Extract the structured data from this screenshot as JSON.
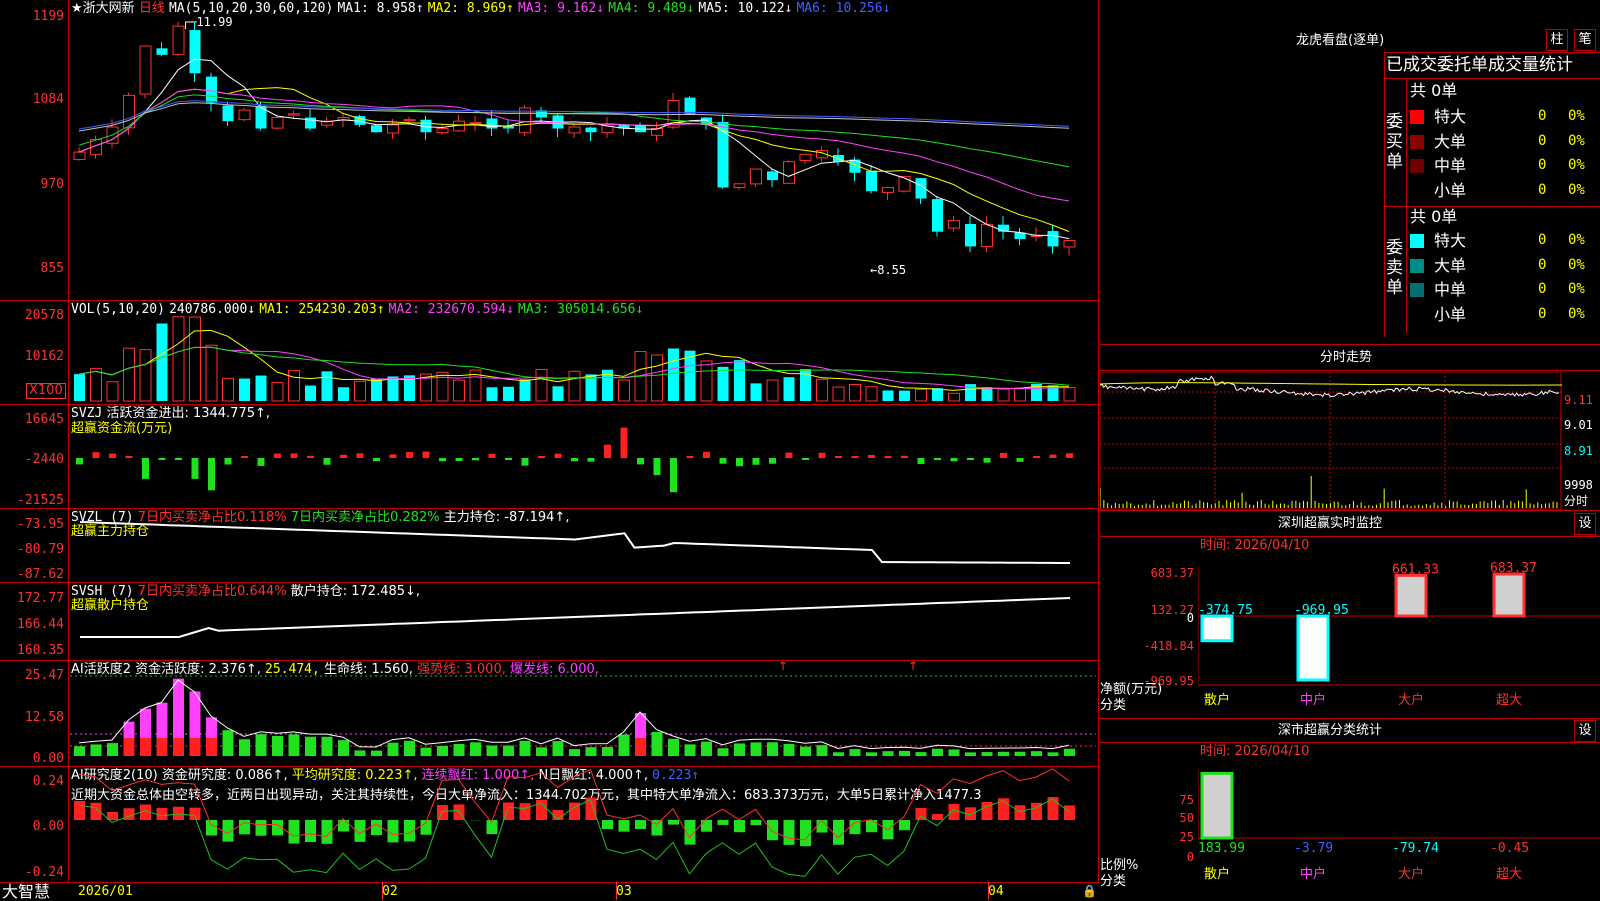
{
  "app": {
    "name": "大智慧"
  },
  "main_header": {
    "star": "★",
    "stock_name": "浙大网新",
    "period": "日线",
    "ma_params": "MA(5,10,20,30,60,120)",
    "ma1": "MA1: 8.958↑",
    "ma2": "MA2: 8.969↑",
    "ma3": "MA3: 9.162↓",
    "ma4": "MA4: 9.489↓",
    "ma5": "MA5: 10.122↓",
    "ma6": "MA6: 10.256↓",
    "high_mark": "11.99",
    "low_mark": "8.55"
  },
  "price_axis": [
    "1199",
    "1084",
    "970",
    "855"
  ],
  "vol_header": {
    "label": "VOL(5,10,20)",
    "value": "240786.000↓",
    "ma1": "MA1: 254230.203↑",
    "ma2": "MA2: 232670.594↓",
    "ma3": "MA3: 305014.656↓"
  },
  "vol_axis": [
    "20578",
    "10162",
    "X100"
  ],
  "svzj_header": {
    "label": "SVZJ",
    "desc": "活跃资金进出: 1344.775↑,",
    "sub": "超赢资金流(万元)"
  },
  "svzj_axis": [
    "16645",
    "-2440",
    "-21525"
  ],
  "svzl_header": {
    "label": "SVZL (7)",
    "a": "7日内买卖净占比0.118%",
    "b": "7日内买卖净占比0.282%",
    "c": "主力持仓: -87.194↑,",
    "sub": "超赢主力持仓"
  },
  "svzl_axis": [
    "-73.95",
    "-80.79",
    "-87.62"
  ],
  "svsh_header": {
    "label": "SVSH (7)",
    "a": "7日内买卖净占比0.644%",
    "c": "散户持仓: 172.485↓,",
    "sub": "超赢散户持仓"
  },
  "svsh_axis": [
    "172.77",
    "166.44",
    "160.35"
  ],
  "ai1_header": {
    "label": "AI活跃度2",
    "a": "资金活跃度: 2.376↑,",
    "b": "25.474,",
    "c": "生命线: 1.560,",
    "d": "强势线: 3.000,",
    "e": "爆发线: 6.000,"
  },
  "ai1_axis": [
    "25.47",
    "12.58",
    "0.00"
  ],
  "ai2_header": {
    "label": "AI研究度2(10)",
    "a": "资金研究度: 0.086↑,",
    "b": "平均研究度: 0.223↑,",
    "c": "连续飘红: 1.000↑,",
    "d": "N日飘红: 4.000↑,",
    "e": "0.223↑"
  },
  "ai2_comment": "近期大资金总体由空转多，近两日出现异动，关注其持续性，今日大单净流入：1344.702万元，其中特大单净流入：683.373万元，大单5日累计净入1477.3",
  "ai2_axis": [
    "0.24",
    "0.00",
    "-0.24"
  ],
  "date_axis": [
    "2026/01",
    "02",
    "03",
    "04"
  ],
  "right_top": {
    "title": "龙虎看盘(逐单)",
    "btn1": "柱",
    "btn2": "笔",
    "tabs": "已成交委托单成交量统计",
    "buy_label": "委买单",
    "sell_label": "委卖单",
    "buy_total": "共 0单",
    "sell_total": "共 0单",
    "buy_rows": [
      {
        "name": "特大",
        "count": "0",
        "pct": "0%"
      },
      {
        "name": "大单",
        "count": "0",
        "pct": "0%"
      },
      {
        "name": "中单",
        "count": "0",
        "pct": "0%"
      },
      {
        "name": "小单",
        "count": "0",
        "pct": "0%"
      }
    ],
    "sell_rows": [
      {
        "name": "特大",
        "count": "0",
        "pct": "0%"
      },
      {
        "name": "大单",
        "count": "0",
        "pct": "0%"
      },
      {
        "name": "中单",
        "count": "0",
        "pct": "0%"
      },
      {
        "name": "小单",
        "count": "0",
        "pct": "0%"
      }
    ],
    "colors": {
      "buy": [
        "#ff0000",
        "#8b0000",
        "#700000",
        "#000000"
      ],
      "sell": [
        "#00ffff",
        "#008b8b",
        "#007070",
        "#000000"
      ]
    }
  },
  "intraday": {
    "title": "分时走势",
    "axis": [
      "9.11",
      "9.01",
      "8.91"
    ],
    "vol_label": "9998",
    "sub": "分时"
  },
  "sz_monitor": {
    "title": "深圳超赢实时监控",
    "btn": "设",
    "time": "时间: 2026/04/10",
    "axis": [
      "683.37",
      "132.27",
      "0",
      "-418.84",
      "-969.95"
    ],
    "ylabel": "净额(万元)",
    "xlabel": "分类",
    "categories": [
      "散户",
      "中户",
      "大户",
      "超大"
    ],
    "values": [
      -374.75,
      -969.95,
      661.33,
      683.37
    ],
    "labels": [
      "-374.75",
      "-969.95",
      "661.33",
      "683.37"
    ]
  },
  "sz_class": {
    "title": "深市超赢分类统计",
    "btn": "设",
    "time": "时间: 2026/04/10",
    "axis": [
      "75",
      "50",
      "25",
      "0"
    ],
    "ylabel": "比例%",
    "xlabel": "分类",
    "categories": [
      "散户",
      "中户",
      "大户",
      "超大"
    ],
    "values": [
      183.99,
      -3.79,
      -79.74,
      -0.45
    ],
    "labels": [
      "183.99",
      "-3.79",
      "-79.74",
      "-0.45"
    ]
  },
  "chart_data": [
    {
      "type": "candlestick",
      "title": "浙大网新 日线",
      "ylim": [
        8.3,
        12.1
      ],
      "x": [
        "2026/01",
        "02",
        "03",
        "04"
      ],
      "series": [
        {
          "name": "MA1",
          "values": [
            8.958
          ]
        },
        {
          "name": "MA2",
          "values": [
            8.969
          ]
        },
        {
          "name": "MA3",
          "values": [
            9.162
          ]
        },
        {
          "name": "MA4",
          "values": [
            9.489
          ]
        },
        {
          "name": "MA5",
          "values": [
            10.122
          ]
        },
        {
          "name": "MA6",
          "values": [
            10.256
          ]
        }
      ],
      "annotations": [
        "11.99",
        "8.55"
      ]
    },
    {
      "type": "bar",
      "title": "VOL(5,10,20)",
      "series": [
        {
          "name": "MA1",
          "values": [
            254230.203
          ]
        },
        {
          "name": "MA2",
          "values": [
            232670.594
          ]
        },
        {
          "name": "MA3",
          "values": [
            305014.656
          ]
        }
      ]
    },
    {
      "type": "bar",
      "title": "深圳超赢实时监控",
      "categories": [
        "散户",
        "中户",
        "大户",
        "超大"
      ],
      "values": [
        -374.75,
        -969.95,
        661.33,
        683.37
      ],
      "ylabel": "净额(万元)",
      "xlabel": "分类",
      "ylim": [
        -969.95,
        683.37
      ]
    },
    {
      "type": "bar",
      "title": "深市超赢分类统计",
      "categories": [
        "散户",
        "中户",
        "大户",
        "超大"
      ],
      "values": [
        183.99,
        -3.79,
        -79.74,
        -0.45
      ],
      "ylabel": "比例%",
      "xlabel": "分类",
      "ylim": [
        0,
        80
      ]
    }
  ]
}
